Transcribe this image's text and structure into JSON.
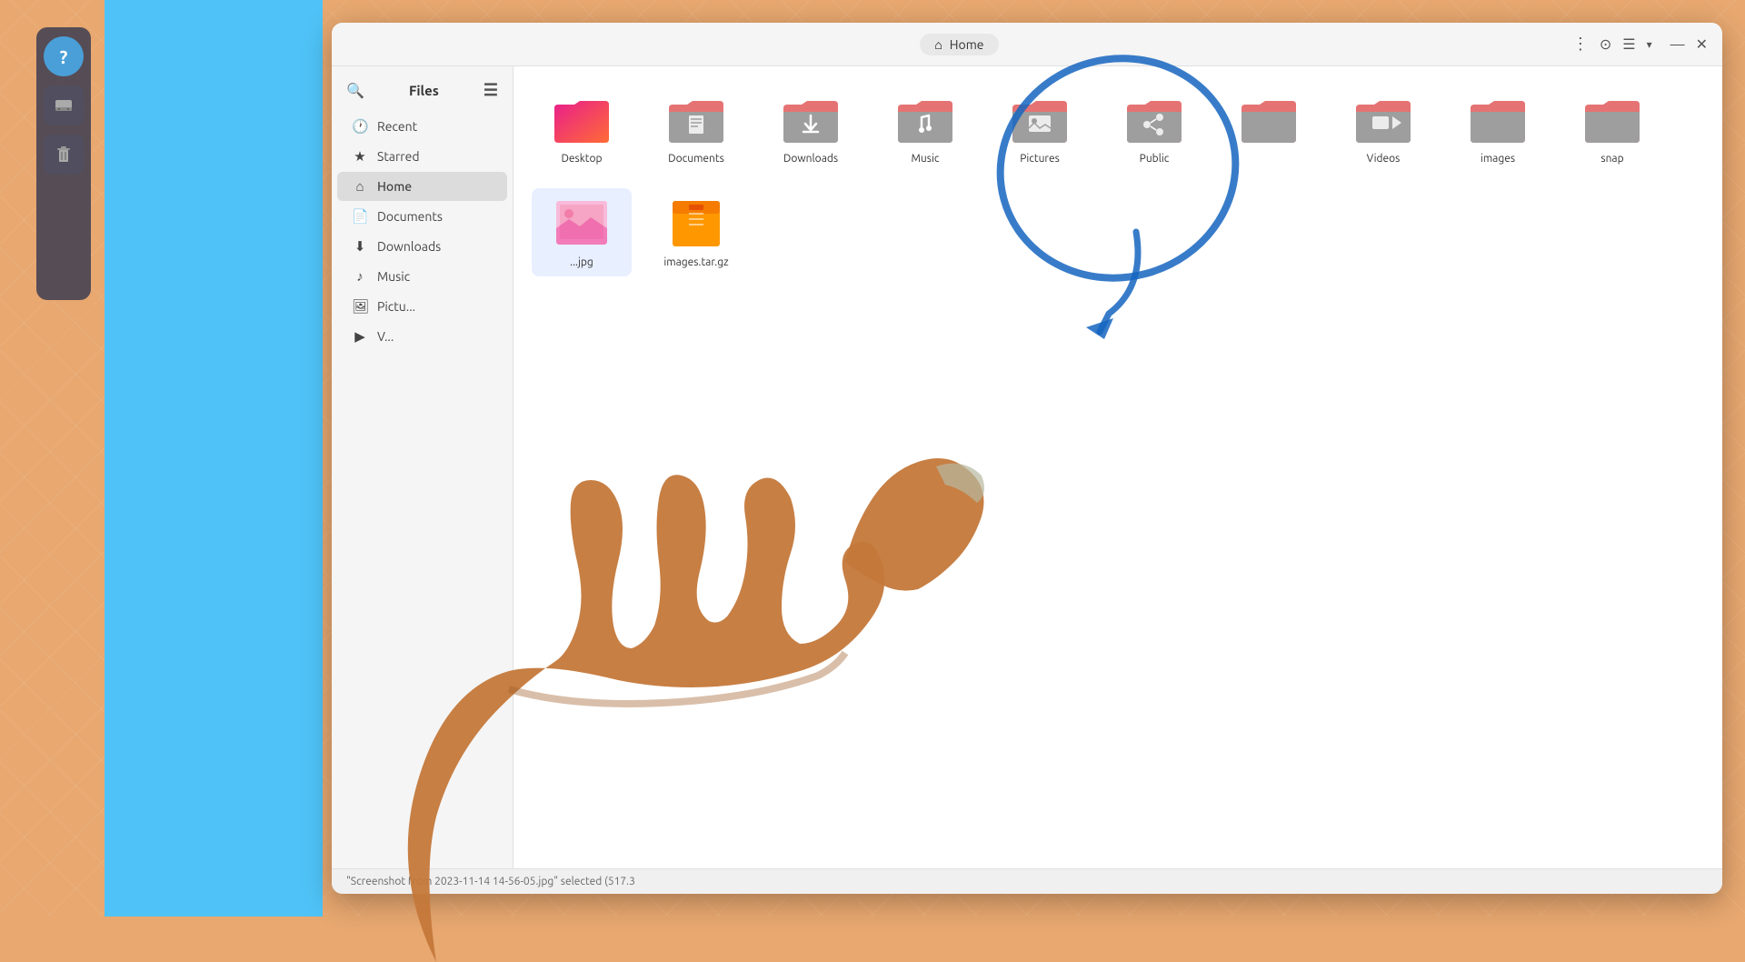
{
  "background": {
    "color": "#e8a870"
  },
  "taskbar": {
    "items": [
      {
        "id": "question-btn",
        "type": "blue",
        "label": "?"
      },
      {
        "id": "drive-icon",
        "type": "dark",
        "label": "drive"
      },
      {
        "id": "trash-icon",
        "type": "dark",
        "label": "trash"
      }
    ]
  },
  "window": {
    "title": "Files",
    "location": "Home",
    "titlebar": {
      "menu_icon": "☰",
      "search_icon": "🔍",
      "more_options": "⋮",
      "camera_icon": "📷",
      "view_options": "☰",
      "minimize_label": "minimize",
      "close_label": "close"
    }
  },
  "sidebar": {
    "title": "Files",
    "items": [
      {
        "id": "recent",
        "icon": "🕐",
        "label": "Recent"
      },
      {
        "id": "starred",
        "icon": "★",
        "label": "Starred"
      },
      {
        "id": "home",
        "icon": "⌂",
        "label": "Home",
        "active": true
      },
      {
        "id": "documents",
        "icon": "📄",
        "label": "Documents"
      },
      {
        "id": "downloads",
        "icon": "⬇",
        "label": "Downloads"
      },
      {
        "id": "music",
        "icon": "♪",
        "label": "Music"
      },
      {
        "id": "pictures",
        "icon": "🖼",
        "label": "Pictu..."
      },
      {
        "id": "videos",
        "icon": "▶",
        "label": "V..."
      }
    ]
  },
  "files": {
    "rows": [
      [
        {
          "id": "desktop",
          "label": "Desktop",
          "type": "special-folder",
          "color": "gradient"
        },
        {
          "id": "documents",
          "label": "Documents",
          "type": "folder",
          "tab": "pink"
        },
        {
          "id": "downloads",
          "label": "Downloads",
          "type": "folder",
          "tab": "pink"
        },
        {
          "id": "music",
          "label": "Music",
          "type": "folder",
          "tab": "pink"
        },
        {
          "id": "pictures",
          "label": "Pictures",
          "type": "folder",
          "tab": "pink"
        },
        {
          "id": "public",
          "label": "Public",
          "type": "folder-share",
          "tab": "pink"
        }
      ],
      [
        {
          "id": "templates",
          "label": "",
          "type": "folder",
          "tab": "pink"
        },
        {
          "id": "videos",
          "label": "Videos",
          "type": "folder",
          "tab": "pink"
        },
        {
          "id": "images",
          "label": "images",
          "type": "folder",
          "tab": "pink"
        },
        {
          "id": "snap",
          "label": "snap",
          "type": "folder",
          "tab": "pink"
        },
        {
          "id": "selected-img",
          "label": "...jpg",
          "type": "image",
          "selected": true
        },
        {
          "id": "images-tar",
          "label": "images.tar.gz",
          "type": "archive"
        }
      ]
    ]
  },
  "statusbar": {
    "text": "\"Screenshot from 2023-11-14 14-56-05.jpg\" selected  (517.3"
  }
}
